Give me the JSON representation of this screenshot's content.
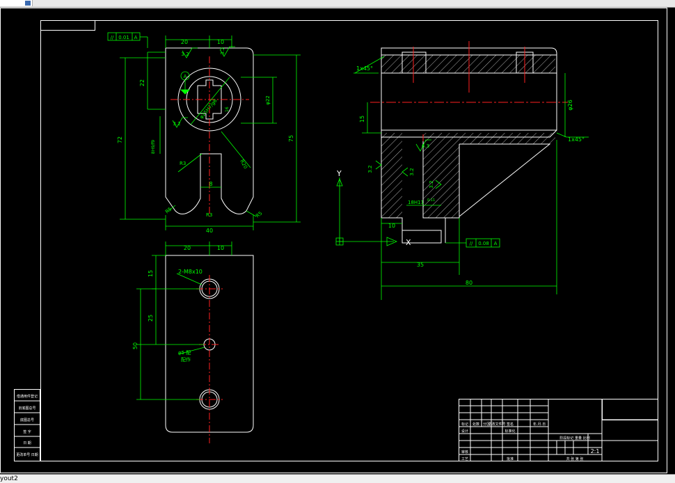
{
  "app": {
    "layout_tab": "yout2"
  },
  "colors": {
    "background": "#000000",
    "border": "#ffffff",
    "part": "#ffffff",
    "dimension": "#00ff00",
    "centerline": "#ff2020",
    "tabbar": "#e8e8e8"
  },
  "icons": {
    "ucs": "ucs-icon"
  },
  "front_view": {
    "dims": {
      "top_20": "20",
      "top_10": "10",
      "left_22": "22",
      "left_72": "72",
      "right_75": "75",
      "bottom_40": "40",
      "slot_8": "8",
      "bore": "φ25H7/g6",
      "bore_r": "φ22",
      "r3a": "R3",
      "r3b": "R3",
      "r20": "R20",
      "r5a": "R5",
      "r5b": "R5",
      "side_tol": "8H9/f9",
      "small_16": "16"
    },
    "tolerance": {
      "symbol": "//",
      "value": "0.01",
      "datum": "A"
    },
    "roughness": {
      "r1": "3.2",
      "r2": "3.2",
      "r3": "3.2"
    },
    "datum_label": "A"
  },
  "bottom_view": {
    "dims": {
      "top_20": "20",
      "top_10": "10",
      "left_15": "15",
      "left_25": "25",
      "left_50": "50"
    },
    "note_holes": "2-M8x10",
    "note_pin": "φ5 配",
    "note_pin2": "配作"
  },
  "section_view": {
    "dims": {
      "chamfer_top": "1x45°",
      "chamfer_right": "1x45°",
      "dia_26": "φ26",
      "left_15": "15",
      "d_10": "10",
      "d_35": "35",
      "d_80": "80",
      "fit": "18H11",
      "fit_sub": "0.11"
    },
    "tolerance": {
      "symbol": "//",
      "value": "0.08",
      "datum": "A"
    },
    "roughness": {
      "r1": "6.3",
      "r2": "3.2",
      "r3": "3.2",
      "r4": "3.2"
    },
    "ucs_y": "Y",
    "ucs_x": "X"
  },
  "left_strip": {
    "rows": [
      "借通用件登记",
      "旧底图总号",
      "底图总号",
      "签 字",
      "日 期",
      "更改单号 日期"
    ]
  },
  "title_block": {
    "row1": [
      "标记",
      "处数",
      "分区",
      "更改文件号",
      "签名",
      "年.月.日"
    ],
    "row2": [
      "设计",
      "标准化"
    ],
    "row3": [
      "审核"
    ],
    "row4": [
      "工艺",
      "批准"
    ],
    "stage_header": "阶段标记  重量  比例",
    "scale": "2:1",
    "sheet": "共  张  第  张"
  }
}
